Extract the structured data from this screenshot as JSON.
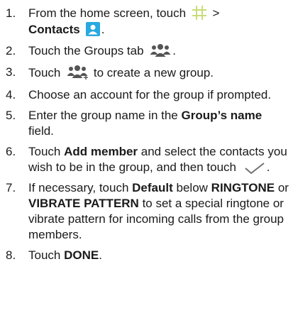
{
  "steps": [
    {
      "num": "1.",
      "t1": "From the home screen, touch",
      "t2": ">",
      "b1": "Contacts",
      "t3": "."
    },
    {
      "num": "2.",
      "t1": "Touch the Groups tab",
      "t2": "."
    },
    {
      "num": "3.",
      "t1": "Touch",
      "t2": "to create a new group."
    },
    {
      "num": "4.",
      "t1": "Choose an account for the group if prompted."
    },
    {
      "num": "5.",
      "t1": "Enter the group name in the",
      "b1": "Group’s name",
      "t2": "field."
    },
    {
      "num": "6.",
      "t1": "Touch",
      "b1": "Add member",
      "t2": "and select the contacts you wish to be in the group, and then touch",
      "t3": "."
    },
    {
      "num": "7.",
      "t1": "If necessary, touch",
      "b1": "Default",
      "t2": "below",
      "b2": "RINGTONE",
      "t3": "or",
      "b3": "VIBRATE PATTERN",
      "t4": "to set a special ringtone or vibrate pattern for incoming calls from the group members."
    },
    {
      "num": "8.",
      "t1": "Touch",
      "b1": "DONE",
      "t2": "."
    }
  ],
  "icons": {
    "apps_grid": "apps-grid-icon",
    "contacts": "contacts-app-icon",
    "groups_tab": "groups-icon",
    "new_group": "add-group-icon",
    "confirm": "checkmark-icon"
  },
  "colors": {
    "text": "#1a1a1a",
    "contacts_icon_bg": "#29a9e1",
    "grid_icon": "#c8dc7a",
    "group_icon": "#555555",
    "check_icon": "#707070"
  }
}
